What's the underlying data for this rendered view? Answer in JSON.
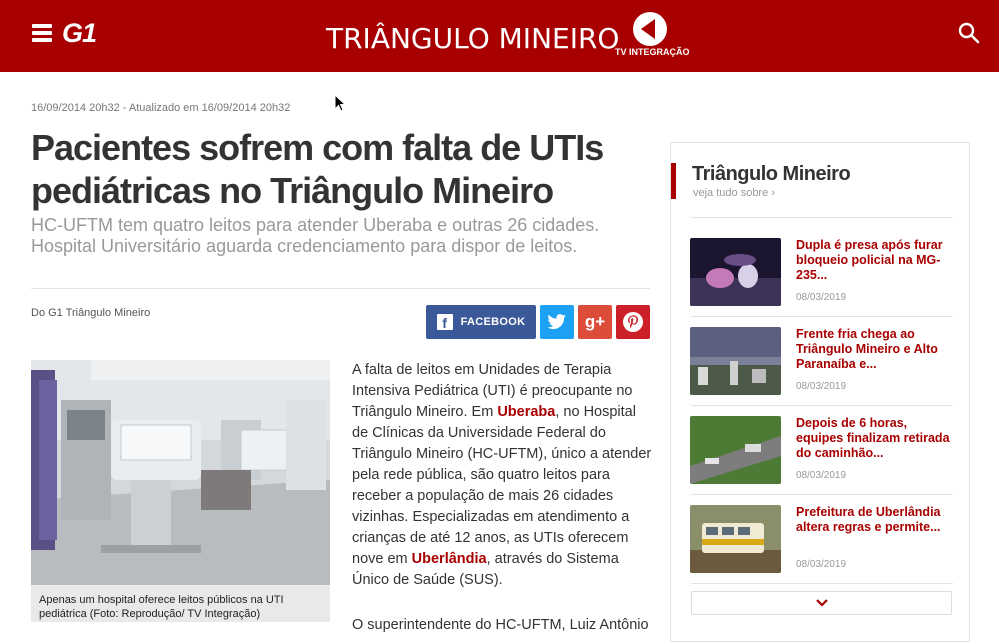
{
  "header": {
    "logo": "G1",
    "section_title": "TRIÂNGULO MINEIRO",
    "tv_logo_text": "TV INTEGRAÇÃO",
    "icons": {
      "menu": "hamburger-menu-icon",
      "search": "search-icon"
    },
    "colors": {
      "bar": "#a80000",
      "text": "#ffffff"
    }
  },
  "article": {
    "timestamp": "16/09/2014 20h32 - Atualizado em 16/09/2014 20h32",
    "headline": "Pacientes sofrem com falta de UTIs pediátricas no Triângulo Mineiro",
    "subtitle": "HC-UFTM tem quatro leitos para atender Uberaba e outras 26 cidades. Hospital Universitário aguarda credenciamento para dispor de leitos.",
    "byline": "Do G1 Triângulo Mineiro",
    "share": {
      "facebook": "FACEBOOK",
      "colors": {
        "facebook": "#3b5998",
        "twitter": "#1da1f2",
        "googleplus": "#dd4b39",
        "pinterest": "#cb2027"
      }
    },
    "photo_caption": "Apenas um hospital oferece leitos públicos na UTI pediátrica (Foto: Reprodução/ TV Integração)",
    "body": {
      "p1_a": "A falta de leitos em Unidades de Terapia Intensiva Pediátrica (UTI) é preocupante no Triângulo Mineiro. Em ",
      "link_uberaba": "Uberaba",
      "p1_b": ", no Hospital de Clínicas da Universidade Federal do Triângulo Mineiro (HC-UFTM), único a atender pela rede pública, são quatro leitos para receber a população de mais 26 cidades vizinhas. Especializadas em atendimento a crianças de até 12 anos, as UTIs oferecem nove em ",
      "link_uberlandia": "Uberlândia",
      "p1_c": ", através do Sistema Único de Saúde (SUS).",
      "p2_partial": "O superintendente do HC-UFTM, Luiz Antônio"
    }
  },
  "sidebar": {
    "title": "Triângulo Mineiro",
    "more": "veja tudo sobre ›",
    "news": [
      {
        "title": "Dupla é presa após furar bloqueio policial na MG-235...",
        "date": "08/03/2019"
      },
      {
        "title": "Frente fria chega ao Triângulo Mineiro e Alto Paranaíba e...",
        "date": "08/03/2019"
      },
      {
        "title": "Depois de 6 horas, equipes finalizam retirada do caminhão...",
        "date": "08/03/2019"
      },
      {
        "title": "Prefeitura de Uberlândia altera regras e permite...",
        "date": "08/03/2019"
      }
    ],
    "accent": "#a80000"
  }
}
